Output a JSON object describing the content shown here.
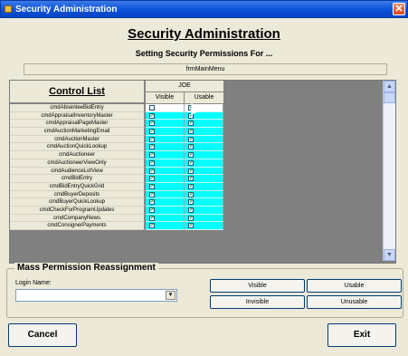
{
  "window": {
    "title": "Security Administration",
    "close_glyph": "✕"
  },
  "header": {
    "title": "Security Administration",
    "subtitle": "Setting Security Permissions For ...",
    "form_name": "frmMainMenu"
  },
  "grid": {
    "control_list_header": "Control List",
    "user": "JOE",
    "visible_header": "Visible",
    "usable_header": "Usable",
    "rows": [
      {
        "name": "cmdAbsenteeBidEntry",
        "visible": false,
        "usable": true
      },
      {
        "name": "cmdAppraisalInventoryMaster",
        "visible": true,
        "usable": true
      },
      {
        "name": "cmdAppraisalPageMaster",
        "visible": true,
        "usable": true
      },
      {
        "name": "cmdAuctionMarketingEmail",
        "visible": true,
        "usable": true
      },
      {
        "name": "cmdAuctionMaster",
        "visible": true,
        "usable": true
      },
      {
        "name": "cmdAuctionQuickLookup",
        "visible": true,
        "usable": true
      },
      {
        "name": "cmdAuctioneer",
        "visible": true,
        "usable": true
      },
      {
        "name": "cmdAuctioneerViewOnly",
        "visible": true,
        "usable": true
      },
      {
        "name": "cmdAudienceLotView",
        "visible": true,
        "usable": true
      },
      {
        "name": "cmdBidEntry",
        "visible": true,
        "usable": true
      },
      {
        "name": "cmdBidEntryQuickGrid",
        "visible": true,
        "usable": true
      },
      {
        "name": "cmdBuyerDeposits",
        "visible": true,
        "usable": true
      },
      {
        "name": "cmdBuyerQuickLookup",
        "visible": true,
        "usable": true
      },
      {
        "name": "cmdCheckForProgramUpdates",
        "visible": true,
        "usable": true
      },
      {
        "name": "cmdCompanyNews",
        "visible": true,
        "usable": true
      },
      {
        "name": "cmdConsignerPayments",
        "visible": true,
        "usable": true
      }
    ],
    "selected_row_color": "#ffffff",
    "row_color": "#00ffff"
  },
  "mass_permission": {
    "title": "Mass Permission Reassignment",
    "login_label": "Login Name:",
    "login_value": "",
    "buttons": {
      "visible": "Visible",
      "usable": "Usable",
      "invisible": "Invisible",
      "unusable": "Unusable"
    }
  },
  "footer": {
    "cancel": "Cancel",
    "exit": "Exit"
  },
  "icons": {
    "scroll_up": "▲",
    "scroll_down": "▼",
    "dropdown": "▾",
    "check": "✔"
  }
}
